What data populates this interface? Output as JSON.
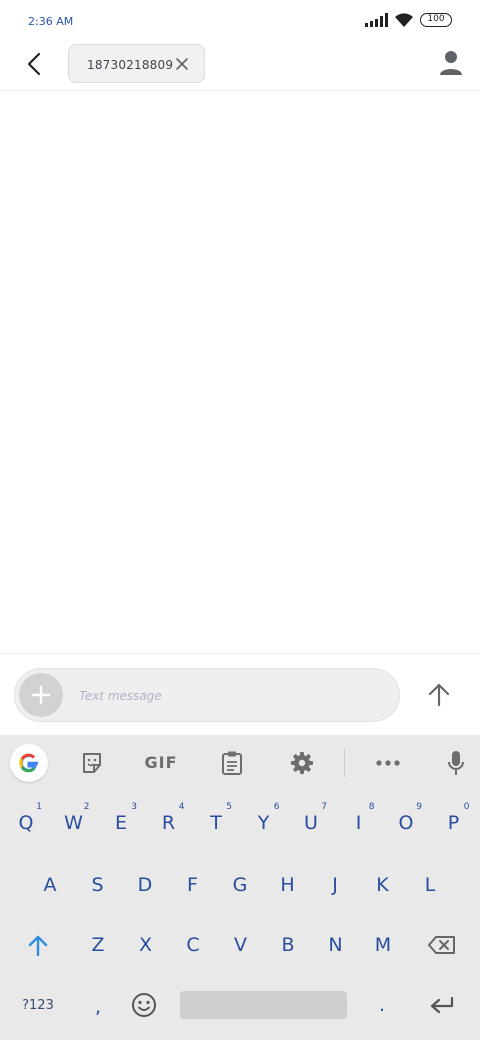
{
  "status_bar": {
    "time": "2:36 AM",
    "battery": "100",
    "icons": [
      "signal-icon",
      "wifi-icon",
      "battery-icon"
    ]
  },
  "header": {
    "back_icon": "back-arrow-icon",
    "recipient": "18730218809",
    "remove_icon": "close-icon",
    "contact_icon": "person-icon"
  },
  "compose": {
    "placeholder": "Text message",
    "value": "",
    "attach_icon": "plus-icon",
    "send_icon": "send-arrow-icon"
  },
  "keyboard_toolbar": {
    "items": [
      "google-icon",
      "sticker-icon",
      "GIF",
      "clipboard-icon",
      "gear-icon",
      "more-icon",
      "mic-icon"
    ],
    "gif_label": "GIF"
  },
  "keyboard": {
    "row1": [
      {
        "label": "Q",
        "hint": "1"
      },
      {
        "label": "W",
        "hint": "2"
      },
      {
        "label": "E",
        "hint": "3"
      },
      {
        "label": "R",
        "hint": "4"
      },
      {
        "label": "T",
        "hint": "5"
      },
      {
        "label": "Y",
        "hint": "6"
      },
      {
        "label": "U",
        "hint": "7"
      },
      {
        "label": "I",
        "hint": "8"
      },
      {
        "label": "O",
        "hint": "9"
      },
      {
        "label": "P",
        "hint": "0"
      }
    ],
    "row2": [
      "A",
      "S",
      "D",
      "F",
      "G",
      "H",
      "J",
      "K",
      "L"
    ],
    "row3": [
      "Z",
      "X",
      "C",
      "V",
      "B",
      "N",
      "M"
    ],
    "symbols_label": "?123",
    "comma_label": ",",
    "period_label": ".",
    "shift_icon": "shift-arrow-icon",
    "backspace_icon": "backspace-icon",
    "emoji_icon": "emoji-icon",
    "enter_icon": "enter-icon"
  },
  "colors": {
    "key_text": "#2a4d9e",
    "keyboard_bg": "#e9e9e9",
    "shift_accent": "#2f8ee0"
  }
}
